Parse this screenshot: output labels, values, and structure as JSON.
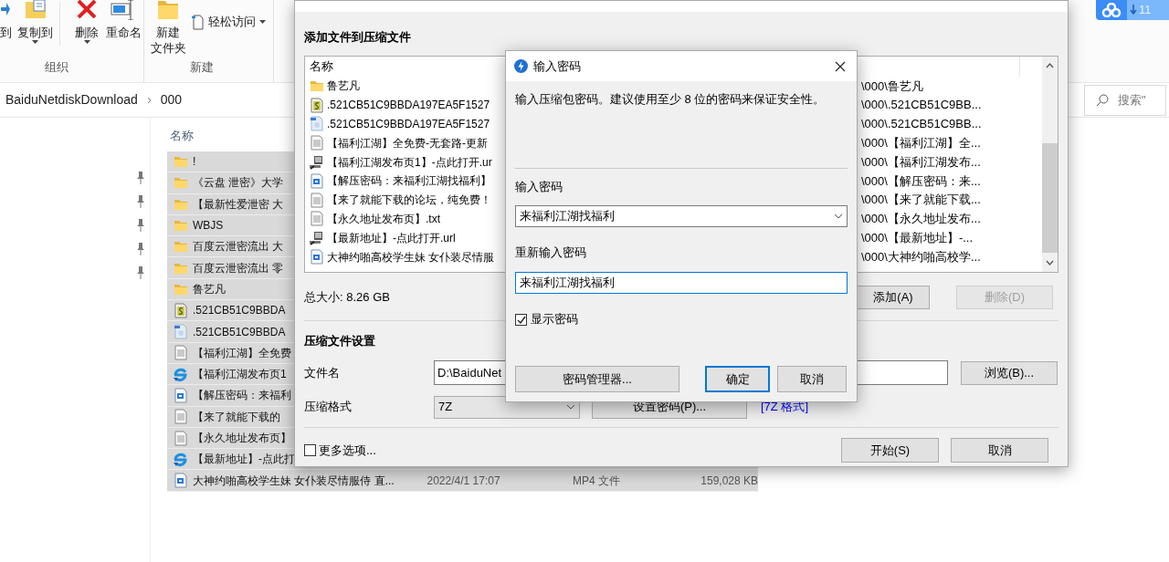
{
  "explorer": {
    "ribbon": {
      "groups": [
        {
          "label": "组织",
          "buttons": [
            {
              "kind": "move",
              "lines": [
                "到"
              ],
              "dropdown": false
            },
            {
              "kind": "copy",
              "lines": [
                "复制到"
              ],
              "dropdown": true
            },
            {
              "kind": "delete",
              "lines": [
                "删除"
              ],
              "dropdown": true
            },
            {
              "kind": "rename",
              "lines": [
                "重命名"
              ],
              "dropdown": false
            }
          ]
        },
        {
          "label": "新建",
          "buttons": [
            {
              "kind": "new-folder",
              "lines": [
                "新建",
                "文件夹"
              ],
              "dropdown": false
            }
          ],
          "small_buttons": [
            {
              "kind": "easy-access",
              "label": "轻松访问",
              "dropdown": true
            }
          ]
        }
      ]
    },
    "address": {
      "segments": [
        "BaiduNetdiskDownload",
        "000"
      ]
    },
    "search": {
      "placeholder": "搜索\""
    },
    "column_header": "名称",
    "files": [
      {
        "kind": "folder",
        "name": "!",
        "selected": true
      },
      {
        "kind": "folder",
        "name": "《云盘 泄密》大学",
        "selected": true
      },
      {
        "kind": "folder",
        "name": "【最新性爱泄密 大",
        "selected": true
      },
      {
        "kind": "folder",
        "name": "WBJS",
        "selected": true
      },
      {
        "kind": "folder",
        "name": "百度云泄密流出 大",
        "selected": true
      },
      {
        "kind": "folder",
        "name": "百度云泄密流出 零",
        "selected": true
      },
      {
        "kind": "folder",
        "name": "鲁艺凡",
        "selected": true
      },
      {
        "kind": "ini",
        "name": ".521CB51C9BBDA",
        "selected": true
      },
      {
        "kind": "image",
        "name": ".521CB51C9BBDA",
        "selected": true
      },
      {
        "kind": "text",
        "name": "【福利江湖】全免费",
        "selected": true
      },
      {
        "kind": "link",
        "name": "【福利江湖发布页1",
        "selected": true
      },
      {
        "kind": "media",
        "name": "【解压密码：来福利",
        "selected": true
      },
      {
        "kind": "text",
        "name": "【来了就能下载的",
        "selected": true
      },
      {
        "kind": "text",
        "name": "【永久地址发布页】",
        "selected": true
      },
      {
        "kind": "link",
        "name": "【最新地址】-点此打",
        "selected": true
      },
      {
        "kind": "media",
        "name": "大神约啪高校学生妹 女仆装尽情服侍 直...",
        "selected": true,
        "date": "2022/4/1 17:07",
        "type": "MP4 文件",
        "size": "159,028 KB"
      }
    ]
  },
  "netdisk_widget": {
    "count": "11"
  },
  "archive_dialog": {
    "heading": "添加文件到压缩文件",
    "list_header": "名称",
    "items": [
      {
        "kind": "folder",
        "name": "鲁艺凡",
        "path": "\\000\\鲁艺凡"
      },
      {
        "kind": "ini",
        "name": ".521CB51C9BBDA197EA5F1527",
        "path": "\\000\\.521CB51C9BB..."
      },
      {
        "kind": "image",
        "name": ".521CB51C9BBDA197EA5F1527",
        "path": "\\000\\.521CB51C9BB..."
      },
      {
        "kind": "text",
        "name": "【福利江湖】全免费-无套路-更新",
        "path": "\\000\\【福利江湖】全..."
      },
      {
        "kind": "link",
        "name": "【福利江湖发布页1】-点此打开.ur",
        "path": "\\000\\【福利江湖发布..."
      },
      {
        "kind": "media",
        "name": "【解压密码：来福利江湖找福利】",
        "path": "\\000\\【解压密码：来..."
      },
      {
        "kind": "text",
        "name": "【来了就能下载的论坛，纯免费！",
        "path": "\\000\\【来了就能下载..."
      },
      {
        "kind": "text",
        "name": "【永久地址发布页】.txt",
        "path": "\\000\\【永久地址发布..."
      },
      {
        "kind": "link",
        "name": "【最新地址】-点此打开.url",
        "path": "\\000\\【最新地址】-..."
      },
      {
        "kind": "media",
        "name": "大神约啪高校学生妹 女仆装尽情服",
        "path": "\\000\\大神约啪高校学..."
      }
    ],
    "total_size": "总大小: 8.26 GB",
    "list_buttons": [
      {
        "label": "添加(A)",
        "disabled": false
      },
      {
        "label": "删除(D)",
        "disabled": true
      }
    ],
    "settings_heading": "压缩文件设置",
    "filename": {
      "label": "文件名",
      "value": "D:\\BaiduNet",
      "browse": "浏览(B)..."
    },
    "format": {
      "label": "压缩格式",
      "value": "7Z",
      "password_button": "设置密码(P)...",
      "link": "[7Z 格式]"
    },
    "more_options": {
      "label": "更多选项...",
      "checked": false
    },
    "buttons": [
      {
        "label": "开始(S)"
      },
      {
        "label": "取消"
      }
    ]
  },
  "password_dialog": {
    "title": "输入密码",
    "hint": "输入压缩包密码。建议使用至少 8 位的密码来保证安全性。",
    "password_label": "输入密码",
    "password": "来福利江湖找福利",
    "confirm_label": "重新输入密码",
    "confirm": "来福利江湖找福利",
    "show_password": {
      "label": "显示密码",
      "checked": true
    },
    "buttons": [
      {
        "label": "密码管理器...",
        "default": false
      },
      {
        "label": "确定",
        "default": true
      },
      {
        "label": "取消",
        "default": false
      }
    ]
  }
}
